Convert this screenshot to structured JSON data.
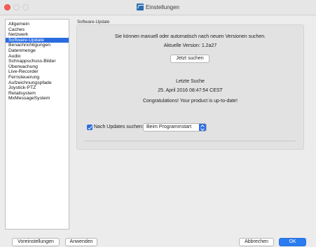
{
  "window": {
    "title": "Einstellungen"
  },
  "sidebar": {
    "items": [
      {
        "label": "Allgemein",
        "selected": false
      },
      {
        "label": "Caches",
        "selected": false
      },
      {
        "label": "Netzwerk",
        "selected": false
      },
      {
        "label": "Software-Update",
        "selected": true
      },
      {
        "label": "Benachrichtigungen",
        "selected": false
      },
      {
        "label": "Datenmenge",
        "selected": false
      },
      {
        "label": "Audio",
        "selected": false
      },
      {
        "label": "Schnappschuss-Bilder",
        "selected": false
      },
      {
        "label": "Überwachung",
        "selected": false
      },
      {
        "label": "Live-Recorder",
        "selected": false
      },
      {
        "label": "Fernsteuerung",
        "selected": false
      },
      {
        "label": "Aufzeichnungspfade",
        "selected": false
      },
      {
        "label": "Joystick-PTZ",
        "selected": false
      },
      {
        "label": "Retailsystem",
        "selected": false
      },
      {
        "label": "MxMessageSystem",
        "selected": false
      }
    ]
  },
  "main": {
    "group_label": "Software-Update",
    "info_text": "Sie können manuell oder automatisch nach neuen Versionen suchen.",
    "current_version": "Aktuelle Version:  1.2a27",
    "search_button": "Jetzt suchen",
    "last_search_label": "Letzte Suche",
    "last_search_date": "25. April 2016 08:47:54 CEST",
    "status_message": "Congratulations! Your product is up-to-date!",
    "auto_update": {
      "checked": true,
      "label": "Nach Updates suchen:",
      "selected_option": "Beim Programmstart"
    }
  },
  "footer": {
    "defaults_button": "Voreinstellungen",
    "apply_button": "Anwenden",
    "cancel_button": "Abbrechen",
    "ok_button": "OK"
  },
  "colors": {
    "accent": "#2a6ce0",
    "close_button": "#fc5b57"
  }
}
